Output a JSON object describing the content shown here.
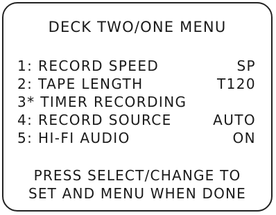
{
  "menu": {
    "title": "DECK TWO/ONE MENU",
    "items": [
      {
        "number": "1",
        "separator": ":",
        "label": "RECORD SPEED",
        "value": "SP"
      },
      {
        "number": "2",
        "separator": ":",
        "label": "TAPE LENGTH",
        "value": "T120"
      },
      {
        "number": "3",
        "separator": "*",
        "label": "TIMER RECORDING",
        "value": ""
      },
      {
        "number": "4",
        "separator": ":",
        "label": "RECORD SOURCE",
        "value": "AUTO"
      },
      {
        "number": "5",
        "separator": ":",
        "label": "HI-FI AUDIO",
        "value": "ON"
      }
    ],
    "instructions": {
      "line1": "PRESS SELECT/CHANGE TO",
      "line2": "SET AND MENU WHEN DONE"
    }
  },
  "colors": {
    "text": "#1a1a1a",
    "border": "#222222",
    "background": "#ffffff"
  }
}
